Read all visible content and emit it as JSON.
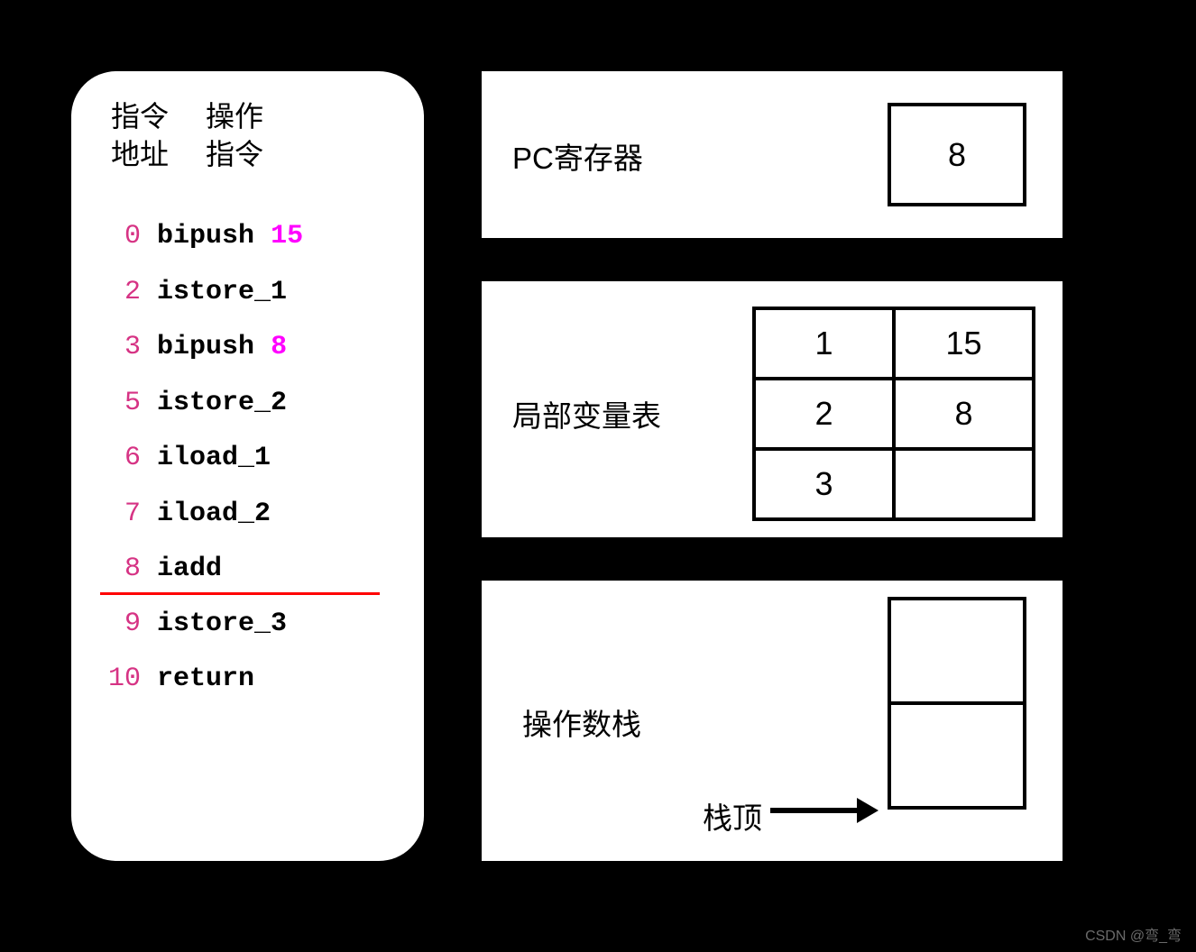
{
  "left": {
    "header_col1_line1": "指令",
    "header_col1_line2": "地址",
    "header_col2_line1": "操作",
    "header_col2_line2": "指令",
    "instructions": [
      {
        "addr": "0",
        "op": "bipush",
        "arg": "15",
        "argColor": "magenta"
      },
      {
        "addr": "2",
        "op": "istore_1",
        "arg": "",
        "argColor": ""
      },
      {
        "addr": "3",
        "op": "bipush",
        "arg": "8",
        "argColor": "magenta"
      },
      {
        "addr": "5",
        "op": "istore_2",
        "arg": "",
        "argColor": ""
      },
      {
        "addr": "6",
        "op": "iload_1",
        "arg": "",
        "argColor": ""
      },
      {
        "addr": "7",
        "op": "iload_2",
        "arg": "",
        "argColor": ""
      },
      {
        "addr": "8",
        "op": "iadd",
        "arg": "",
        "argColor": "",
        "underline": true
      },
      {
        "addr": "9",
        "op": "istore_3",
        "arg": "",
        "argColor": ""
      },
      {
        "addr": "10",
        "op": "return",
        "arg": "",
        "argColor": ""
      }
    ]
  },
  "pc": {
    "label": "PC寄存器",
    "value": "8"
  },
  "localVars": {
    "label": "局部变量表",
    "rows": [
      {
        "index": "1",
        "value": "15"
      },
      {
        "index": "2",
        "value": "8"
      },
      {
        "index": "3",
        "value": ""
      }
    ]
  },
  "opStack": {
    "label": "操作数栈",
    "topLabel": "栈顶",
    "cells": [
      "",
      ""
    ]
  },
  "watermark": "CSDN @弯_弯"
}
